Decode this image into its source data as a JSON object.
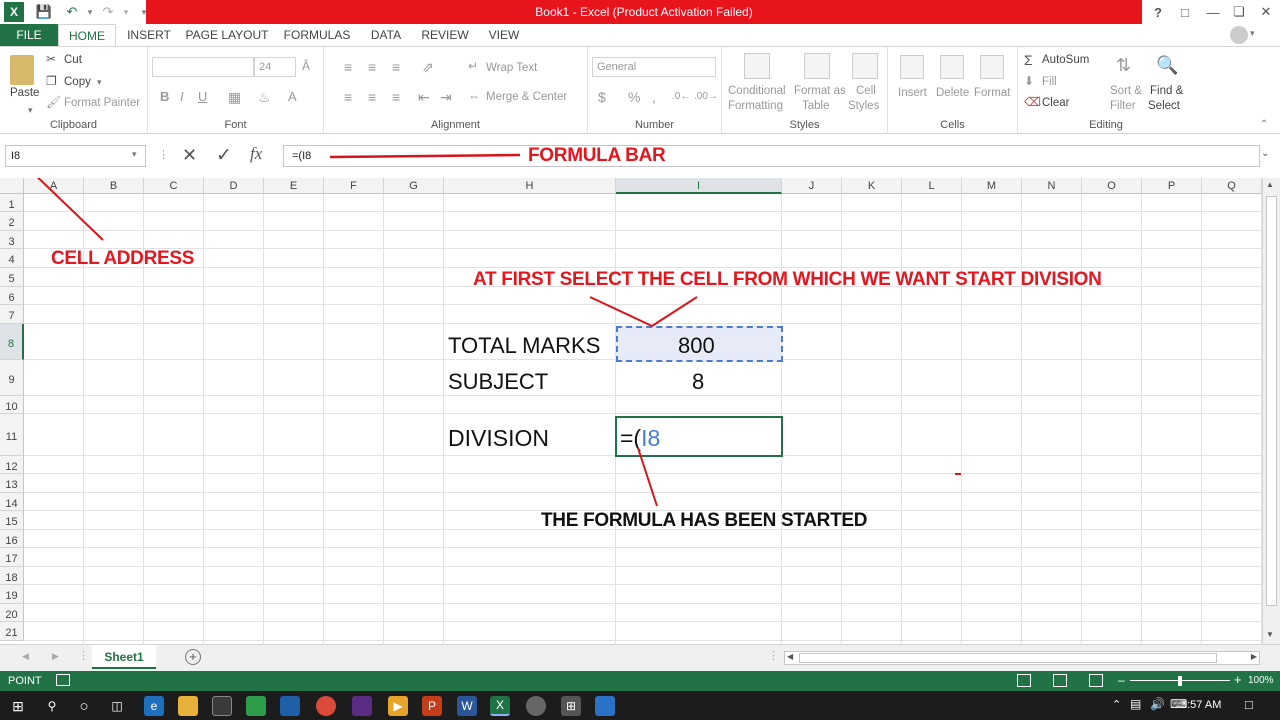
{
  "app": {
    "title": "Book1 -  Excel (Product Activation Failed)",
    "help_label": "?"
  },
  "tabs": [
    {
      "label": "FILE"
    },
    {
      "label": "HOME"
    },
    {
      "label": "INSERT"
    },
    {
      "label": "PAGE LAYOUT"
    },
    {
      "label": "FORMULAS"
    },
    {
      "label": "DATA"
    },
    {
      "label": "REVIEW"
    },
    {
      "label": "VIEW"
    }
  ],
  "ribbon": {
    "clipboard": {
      "group": "Clipboard",
      "paste": "Paste",
      "cut": "Cut",
      "copy": "Copy",
      "format_painter": "Format Painter"
    },
    "font": {
      "group": "Font",
      "font_size": "24"
    },
    "alignment": {
      "group": "Alignment",
      "wrap_text": "Wrap Text",
      "merge_center": "Merge & Center"
    },
    "number": {
      "group": "Number",
      "format": "General",
      "currency": "$",
      "percent": "%",
      "comma": ","
    },
    "styles": {
      "group": "Styles",
      "conditional_1": "Conditional",
      "conditional_2": "Formatting",
      "format_as_1": "Format as",
      "format_as_2": "Table",
      "cell_styles_1": "Cell",
      "cell_styles_2": "Styles"
    },
    "cells": {
      "group": "Cells",
      "insert": "Insert",
      "delete": "Delete",
      "format": "Format"
    },
    "editing": {
      "group": "Editing",
      "autosum": "AutoSum",
      "fill": "Fill",
      "clear": "Clear",
      "sort_1": "Sort &",
      "sort_2": "Filter",
      "find_1": "Find &",
      "find_2": "Select"
    }
  },
  "formula_bar": {
    "name_box": "I8",
    "formula": "=(I8",
    "fx_label": "fx"
  },
  "columns": [
    "A",
    "B",
    "C",
    "D",
    "E",
    "F",
    "G",
    "H",
    "I",
    "J",
    "K",
    "L",
    "M",
    "N",
    "O",
    "P",
    "Q"
  ],
  "rows": [
    "1",
    "2",
    "3",
    "4",
    "5",
    "6",
    "7",
    "8",
    "9",
    "10",
    "11",
    "12",
    "13",
    "14",
    "15",
    "16",
    "17",
    "18",
    "19",
    "20",
    "21"
  ],
  "cells": {
    "h8": "TOTAL MARKS",
    "i8": "800",
    "h9": "SUBJECT",
    "i9": "8",
    "h11": "DIVISION",
    "i11_prefix": "=(",
    "i11_ref": "I8"
  },
  "annotations": {
    "formula_bar": "FORMULA BAR",
    "cell_address": "CELL ADDRESS",
    "select_cell": "AT FIRST SELECT THE CELL FROM WHICH WE WANT START DIVISION",
    "formula_started": "THE FORMULA HAS BEEN STARTED",
    "color": "#e4161e"
  },
  "sheets": [
    {
      "name": "Sheet1"
    }
  ],
  "status": {
    "mode": "POINT",
    "zoom": "100%"
  },
  "taskbar": {
    "time": "9:57 AM"
  },
  "colors": {
    "excel_green": "#217346",
    "title_red": "#e8141c",
    "ref_blue": "#4a7ccf"
  }
}
